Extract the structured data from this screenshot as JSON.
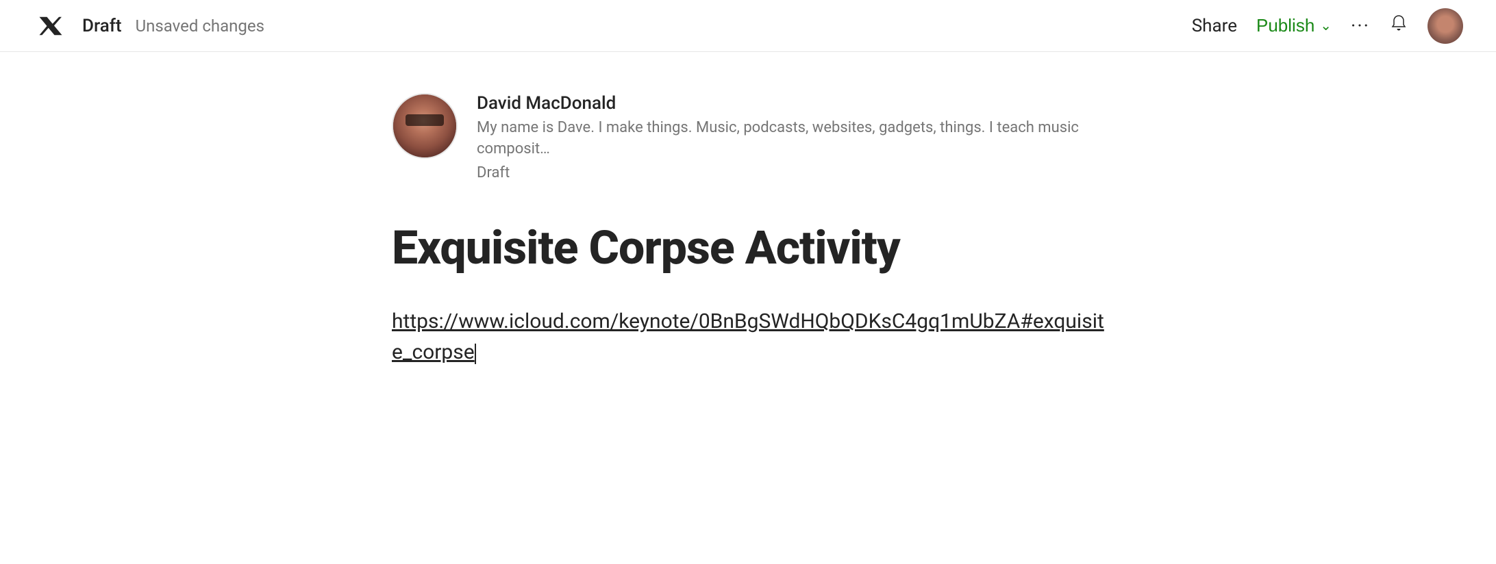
{
  "navbar": {
    "draft_label": "Draft",
    "unsaved_label": "Unsaved changes",
    "share_label": "Share",
    "publish_label": "Publish",
    "chevron": "∨"
  },
  "author": {
    "name": "David MacDonald",
    "bio": "My name is Dave. I make things. Music, podcasts, websites, gadgets, things. I teach music composit…",
    "status": "Draft"
  },
  "article": {
    "title": "Exquisite Corpse Activity",
    "link": "https://www.icloud.com/keynote/0BnBgSWdHQbQDKsC4gq1mUbZA#exquisite_corpse"
  },
  "colors": {
    "publish_green": "#1a8917",
    "text_primary": "#242424",
    "text_secondary": "#757575",
    "border": "#e6e6e6"
  }
}
